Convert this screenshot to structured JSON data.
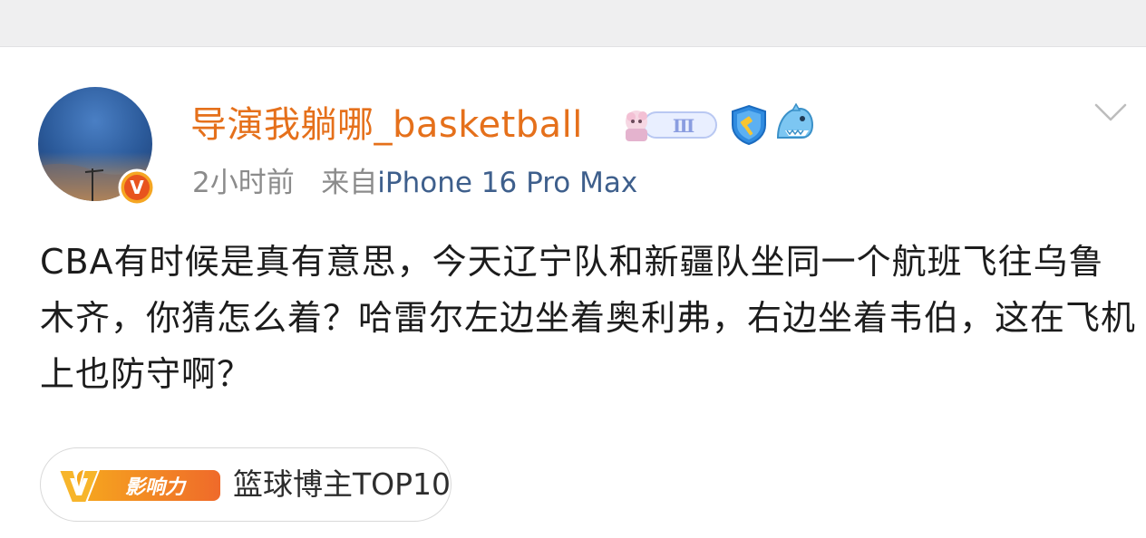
{
  "post": {
    "username": "导演我躺哪_basketball",
    "time": "2小时前",
    "source_prefix": "来自",
    "device": "iPhone 16 Pro Max",
    "content": "CBA有时候是真有意思，今天辽宁队和新疆队坐同一个航班飞往乌鲁木齐，你猜怎么着？哈雷尔左边坐着奥利弗，右边坐着韦伯，这在飞机上也防守啊？",
    "badges": {
      "avatar_verified": "V",
      "medal_roman": "Ⅲ",
      "influence_letter": "V",
      "influence_label": "影响力",
      "rank_label": "篮球博主TOP10"
    },
    "icons": [
      "avatar",
      "verified-badge-icon",
      "fan-medal-icon",
      "shield-icon",
      "shark-icon",
      "chevron-down-icon",
      "influence-icon"
    ]
  },
  "colors": {
    "username": "#e5701b",
    "device_link": "#3e5f8c",
    "meta": "#8b8b8b",
    "text": "#1c1c1c",
    "topbar": "#efeff0"
  }
}
